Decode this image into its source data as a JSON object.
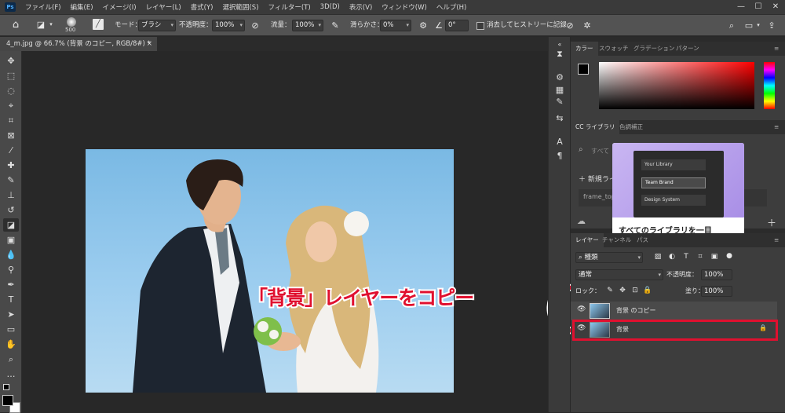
{
  "app": {
    "icon_text": "Ps"
  },
  "menu": [
    "ファイル(F)",
    "編集(E)",
    "イメージ(I)",
    "レイヤー(L)",
    "書式(Y)",
    "選択範囲(S)",
    "フィルター(T)",
    "3D(D)",
    "表示(V)",
    "ウィンドウ(W)",
    "ヘルプ(H)"
  ],
  "window_controls": {
    "minimize": "—",
    "maximize": "☐",
    "close": "✕"
  },
  "options": {
    "brush_size": "500",
    "mode_label": "モード：",
    "mode_value": "ブラシ",
    "opacity_label": "不透明度：",
    "opacity_value": "100%",
    "flow_label": "流量：",
    "flow_value": "100%",
    "smoothing_label": "滑らかさ：",
    "smoothing_value": "0%",
    "angle_value": "0°",
    "erase_history_label": "消去してヒストリーに記録"
  },
  "document": {
    "tab_title": "4_m.jpg @ 66.7% (背景 のコピー, RGB/8#) *",
    "tab_close": "×"
  },
  "color_panel": {
    "tabs": [
      "カラー",
      "スウォッチ",
      "グラデーション",
      "パターン"
    ]
  },
  "library_panel": {
    "tabs": [
      "CC ライブラリ",
      "色調補正"
    ],
    "search_placeholder": "すべて",
    "new_library": "新規ライ",
    "item": "frame_top",
    "popup_items": [
      "Your Library",
      "Team Brand",
      "Design System"
    ],
    "popup_caption": "すべてのライブラリを一目"
  },
  "layers_panel": {
    "tabs": [
      "レイヤー",
      "チャンネル",
      "パス"
    ],
    "filter_kind": "種類",
    "blend_mode": "通常",
    "opacity_label": "不透明度：",
    "opacity_value": "100%",
    "lock_label": "ロック：",
    "fill_label": "塗り：",
    "fill_value": "100%",
    "layers": [
      {
        "name": "背景 のコピー",
        "selected": true
      },
      {
        "name": "背景",
        "selected": false,
        "locked": true
      }
    ]
  },
  "annotation": {
    "text": "「背景」レイヤーをコピー",
    "color": "#e0102f"
  },
  "colors": {
    "accent_highlight": "#e0102f",
    "selected_layer": "#4a4a4a",
    "panel_bg": "#3d3d3d"
  }
}
